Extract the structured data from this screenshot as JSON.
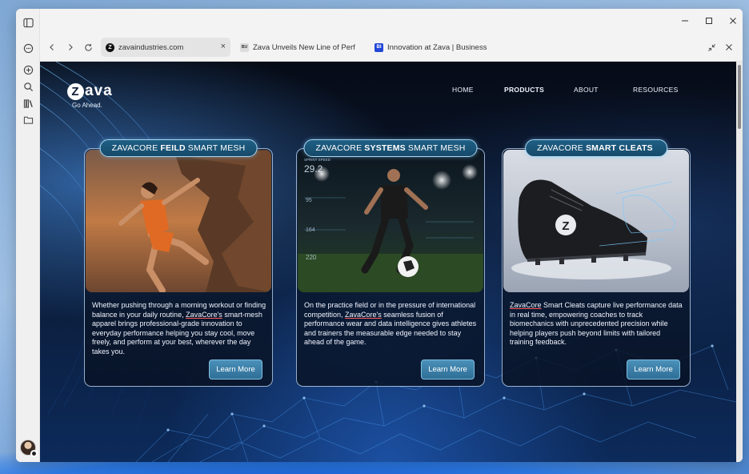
{
  "browser": {
    "tabs": [
      {
        "title": "zavaindustries.com",
        "favicon": "Z",
        "active": true
      },
      {
        "title": "Zava Unveils New Line of Perform",
        "favicon": "BU",
        "active": false
      },
      {
        "title": "Innovation at Zava | Business Insi",
        "favicon": "BI",
        "active": false
      }
    ],
    "close_tab_label": "×"
  },
  "site": {
    "logo_word": "ava",
    "logo_letter": "Z",
    "tagline": "Go Ahead.",
    "nav": [
      "HOME",
      "PRODUCTS",
      "ABOUT",
      "RESOURCES"
    ],
    "current_nav": "PRODUCTS"
  },
  "cards": [
    {
      "pill_pre": "ZAVACORE",
      "pill_bold": "FEILD",
      "pill_post": "SMART MESH",
      "text_pre": "Whether pushing through a morning workout or finding balance in your daily routine, ",
      "brand": "ZavaCore's",
      "text_post": " smart-mesh apparel brings professional-grade innovation to everyday performance helping you stay cool, move freely, and perform at your best, wherever the day takes you.",
      "button": "Learn More"
    },
    {
      "pill_pre": "ZAVACORE",
      "pill_bold": "SYSTEMS",
      "pill_post": "SMART MESH",
      "text_pre": "On the practice field or in the pressure of international competition, ",
      "brand": "ZavaCore's",
      "text_post": " seamless fusion of performance wear and data intelligence gives athletes and trainers the measurable edge needed to stay ahead of the game.",
      "button": "Learn More",
      "hud": {
        "sprint_label": "SPRINT SPEED",
        "sprint_value": "29.2",
        "v2": "95",
        "v3": "164",
        "v4": "220"
      }
    },
    {
      "pill_pre": "ZAVACORE",
      "pill_bold": "SMART CLEATS",
      "pill_post": "",
      "text_pre": "",
      "brand": "ZavaCore",
      "text_post": " Smart Cleats capture live performance data in real time, empowering coaches to track biomechanics with unprecedented precision while helping players push beyond limits with tailored training feedback.",
      "button": "Learn More"
    }
  ],
  "colors": {
    "accent": "#2f6f98",
    "pill": "#1f5f85",
    "page_bg": "#0b1a33"
  }
}
